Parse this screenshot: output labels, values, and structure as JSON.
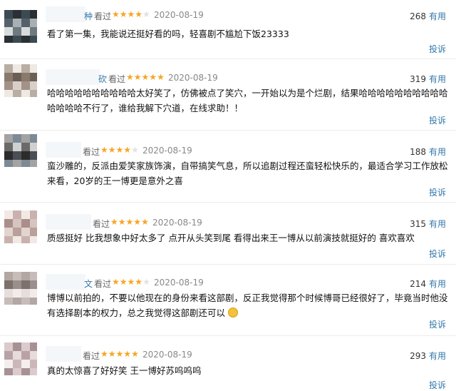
{
  "labels": {
    "watched": "看过",
    "useful": "有用",
    "report": "投诉"
  },
  "colors": {
    "star_on": "#f5a623",
    "star_off": "#e2e2e2",
    "link": "#3377aa"
  },
  "comments": [
    {
      "name_tail": "种",
      "rating": 4,
      "date": "2020-08-19",
      "votes": "268",
      "text": "看了第一集，我能说还挺好看的吗，轻喜剧不尴尬下饭23333"
    },
    {
      "name_tail": "砍",
      "rating": 5,
      "date": "2020-08-19",
      "votes": "319",
      "text": "哈哈哈哈哈哈哈哈哈哈太好笑了，仿佛被点了笑穴，一开始以为是个烂剧，结果哈哈哈哈哈哈哈哈哈哈哈哈哈哈不行了，谁给我解下穴道，在线求助！！"
    },
    {
      "name_tail": "",
      "rating": 4,
      "date": "2020-08-19",
      "votes": "188",
      "text": "蛮沙雕的，反派由爱笑家族饰演，自带搞笑气息，所以追剧过程还蛮轻松快乐的，最适合学习工作放松来看，20岁的王一博更是意外之喜"
    },
    {
      "name_tail": "",
      "rating": 5,
      "date": "2020-08-19",
      "votes": "315",
      "text": "质感挺好 比我想象中好太多了 点开从头笑到尾 看得出来王一博从以前演技就挺好的 喜欢喜欢"
    },
    {
      "name_tail": "文",
      "rating": 4,
      "date": "2020-08-19",
      "votes": "214",
      "text": "博博以前拍的，不要以他现在的身份来看这部剧，反正我觉得那个时候博哥已经很好了，毕竟当时他没有选择剧本的权力，总之我觉得这部剧还可以"
    },
    {
      "name_tail": "",
      "rating": 5,
      "date": "2020-08-19",
      "votes": "293",
      "text": "真的太惊喜了好好笑 王一博好苏呜呜呜"
    }
  ]
}
